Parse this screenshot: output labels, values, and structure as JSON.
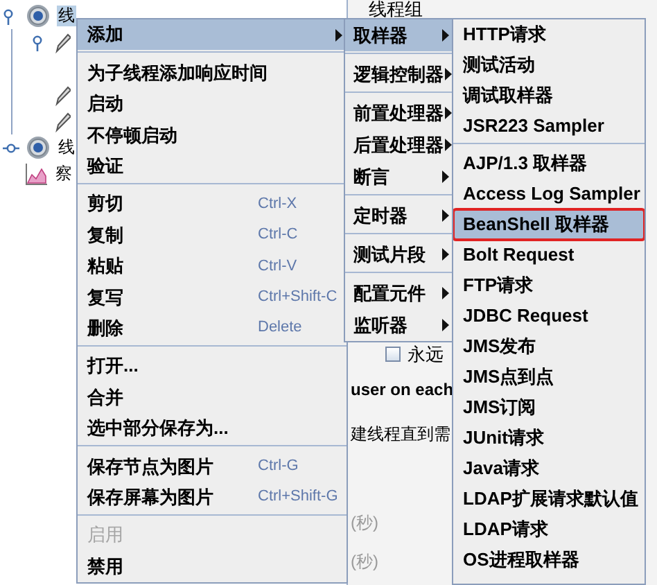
{
  "tree": [
    {
      "kind": "thread_group",
      "label": "线",
      "selected": true,
      "expanded": true,
      "children": [
        {
          "kind": "sampler",
          "expanded": true
        },
        {
          "kind": "sampler"
        },
        {
          "kind": "sampler"
        }
      ]
    },
    {
      "kind": "thread_group",
      "label": "线",
      "selected": false,
      "expanded": false
    },
    {
      "kind": "listener",
      "label": "察",
      "selected": false
    }
  ],
  "panel": {
    "title": "线程组",
    "loop_checkbox": {
      "label": "永远",
      "checked": false
    },
    "fragments": [
      {
        "kind": "bold",
        "text": "user on each"
      },
      {
        "kind": "plain",
        "text": "建线程直到需"
      },
      {
        "kind": "muted",
        "text": "(秒)"
      },
      {
        "kind": "muted",
        "text": "(秒)"
      }
    ]
  },
  "menus": [
    {
      "items": [
        {
          "kind": "item",
          "label": "添加",
          "submenu": true,
          "selected": true,
          "disabled": false
        },
        {
          "kind": "separator"
        },
        {
          "kind": "item",
          "label": "为子线程添加响应时间",
          "submenu": false,
          "selected": false,
          "disabled": false
        },
        {
          "kind": "item",
          "label": "启动",
          "submenu": false,
          "selected": false,
          "disabled": false
        },
        {
          "kind": "item",
          "label": "不停顿启动",
          "submenu": false,
          "selected": false,
          "disabled": false
        },
        {
          "kind": "item",
          "label": "验证",
          "submenu": false,
          "selected": false,
          "disabled": false
        },
        {
          "kind": "separator"
        },
        {
          "kind": "item",
          "label": "剪切",
          "shortcut": "Ctrl-X",
          "submenu": false,
          "selected": false,
          "disabled": false
        },
        {
          "kind": "item",
          "label": "复制",
          "shortcut": "Ctrl-C",
          "submenu": false,
          "selected": false,
          "disabled": false
        },
        {
          "kind": "item",
          "label": "粘贴",
          "shortcut": "Ctrl-V",
          "submenu": false,
          "selected": false,
          "disabled": false
        },
        {
          "kind": "item",
          "label": "复写",
          "shortcut": "Ctrl+Shift-C",
          "submenu": false,
          "selected": false,
          "disabled": false
        },
        {
          "kind": "item",
          "label": "删除",
          "shortcut": "Delete",
          "submenu": false,
          "selected": false,
          "disabled": false
        },
        {
          "kind": "separator"
        },
        {
          "kind": "item",
          "label": "打开...",
          "submenu": false,
          "selected": false,
          "disabled": false
        },
        {
          "kind": "item",
          "label": "合并",
          "submenu": false,
          "selected": false,
          "disabled": false
        },
        {
          "kind": "item",
          "label": "选中部分保存为...",
          "submenu": false,
          "selected": false,
          "disabled": false
        },
        {
          "kind": "separator"
        },
        {
          "kind": "item",
          "label": "保存节点为图片",
          "shortcut": "Ctrl-G",
          "submenu": false,
          "selected": false,
          "disabled": false
        },
        {
          "kind": "item",
          "label": "保存屏幕为图片",
          "shortcut": "Ctrl+Shift-G",
          "submenu": false,
          "selected": false,
          "disabled": false
        },
        {
          "kind": "separator"
        },
        {
          "kind": "item",
          "label": "启用",
          "submenu": false,
          "selected": false,
          "disabled": true
        },
        {
          "kind": "item",
          "label": "禁用",
          "submenu": false,
          "selected": false,
          "disabled": false
        }
      ]
    },
    {
      "items": [
        {
          "kind": "item",
          "label": "取样器",
          "submenu": true,
          "selected": true
        },
        {
          "kind": "separator"
        },
        {
          "kind": "item",
          "label": "逻辑控制器",
          "submenu": true,
          "selected": false
        },
        {
          "kind": "separator"
        },
        {
          "kind": "item",
          "label": "前置处理器",
          "submenu": true,
          "selected": false
        },
        {
          "kind": "item",
          "label": "后置处理器",
          "submenu": true,
          "selected": false
        },
        {
          "kind": "item",
          "label": "断言",
          "submenu": true,
          "selected": false
        },
        {
          "kind": "separator"
        },
        {
          "kind": "item",
          "label": "定时器",
          "submenu": true,
          "selected": false
        },
        {
          "kind": "separator"
        },
        {
          "kind": "item",
          "label": "测试片段",
          "submenu": true,
          "selected": false
        },
        {
          "kind": "separator"
        },
        {
          "kind": "item",
          "label": "配置元件",
          "submenu": true,
          "selected": false
        },
        {
          "kind": "item",
          "label": "监听器",
          "submenu": true,
          "selected": false
        }
      ]
    },
    {
      "items": [
        {
          "kind": "item",
          "label": "HTTP请求",
          "selected": false,
          "outlined": false
        },
        {
          "kind": "item",
          "label": "测试活动",
          "selected": false,
          "outlined": false
        },
        {
          "kind": "item",
          "label": "调试取样器",
          "selected": false,
          "outlined": false
        },
        {
          "kind": "item",
          "label": "JSR223 Sampler",
          "selected": false,
          "outlined": false
        },
        {
          "kind": "separator"
        },
        {
          "kind": "item",
          "label": "AJP/1.3 取样器",
          "selected": false,
          "outlined": false
        },
        {
          "kind": "item",
          "label": "Access Log Sampler",
          "selected": false,
          "outlined": false
        },
        {
          "kind": "item",
          "label": "BeanShell 取样器",
          "selected": true,
          "outlined": true
        },
        {
          "kind": "item",
          "label": "Bolt Request",
          "selected": false,
          "outlined": false
        },
        {
          "kind": "item",
          "label": "FTP请求",
          "selected": false,
          "outlined": false
        },
        {
          "kind": "item",
          "label": "JDBC Request",
          "selected": false,
          "outlined": false
        },
        {
          "kind": "item",
          "label": "JMS发布",
          "selected": false,
          "outlined": false
        },
        {
          "kind": "item",
          "label": "JMS点到点",
          "selected": false,
          "outlined": false
        },
        {
          "kind": "item",
          "label": "JMS订阅",
          "selected": false,
          "outlined": false
        },
        {
          "kind": "item",
          "label": "JUnit请求",
          "selected": false,
          "outlined": false
        },
        {
          "kind": "item",
          "label": "Java请求",
          "selected": false,
          "outlined": false
        },
        {
          "kind": "item",
          "label": "LDAP扩展请求默认值",
          "selected": false,
          "outlined": false
        },
        {
          "kind": "item",
          "label": "LDAP请求",
          "selected": false,
          "outlined": false
        },
        {
          "kind": "item",
          "label": "OS进程取样器",
          "selected": false,
          "outlined": false
        }
      ]
    }
  ]
}
